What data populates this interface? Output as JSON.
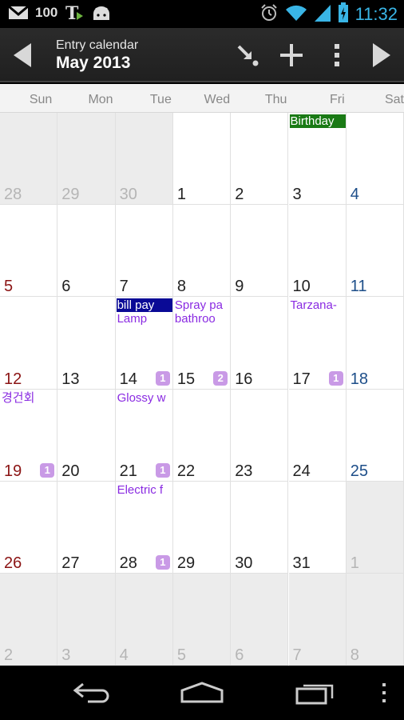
{
  "status_bar": {
    "battery_or_count": "100",
    "time": "11:32",
    "icons": [
      "gmail-icon",
      "talk-icon",
      "android-icon",
      "alarm-icon",
      "wifi-icon",
      "signal-icon",
      "battery-icon"
    ]
  },
  "action_bar": {
    "subtitle": "Entry calendar",
    "title": "May 2013",
    "buttons": [
      "prev-month-icon",
      "today-icon",
      "add-icon",
      "overflow-menu-icon",
      "next-month-icon"
    ]
  },
  "weekdays": [
    "Sun",
    "Mon",
    "Tue",
    "Wed",
    "Thu",
    "Fri",
    "Sat"
  ],
  "colors": {
    "sunday": "#8b1414",
    "saturday": "#1d4e89",
    "event_text": "#8a2be2",
    "badge": "#c99ae6",
    "event_green": "#1a7a15",
    "event_blue": "#0a0a96",
    "accent": "#39b5e6"
  },
  "weeks": [
    [
      {
        "day": "28",
        "other": true
      },
      {
        "day": "29",
        "other": true
      },
      {
        "day": "30",
        "other": true
      },
      {
        "day": "1"
      },
      {
        "day": "2"
      },
      {
        "day": "3",
        "events": [
          {
            "text": "Birthday",
            "style": "bar-green"
          }
        ]
      },
      {
        "day": "4"
      }
    ],
    [
      {
        "day": "5"
      },
      {
        "day": "6"
      },
      {
        "day": "7"
      },
      {
        "day": "8"
      },
      {
        "day": "9"
      },
      {
        "day": "10"
      },
      {
        "day": "11"
      }
    ],
    [
      {
        "day": "12"
      },
      {
        "day": "13"
      },
      {
        "day": "14",
        "badge": "1",
        "events": [
          {
            "text": "bill pay",
            "style": "bar-blue"
          },
          {
            "text": "Lamp"
          }
        ]
      },
      {
        "day": "15",
        "badge": "2",
        "events": [
          {
            "text": "Spray pa"
          },
          {
            "text": "bathroo"
          }
        ]
      },
      {
        "day": "16"
      },
      {
        "day": "17",
        "badge": "1",
        "events": [
          {
            "text": "Tarzana-"
          }
        ]
      },
      {
        "day": "18"
      }
    ],
    [
      {
        "day": "19",
        "badge": "1",
        "events": [
          {
            "text": "경건회"
          }
        ]
      },
      {
        "day": "20"
      },
      {
        "day": "21",
        "badge": "1",
        "events": [
          {
            "text": "Glossy w"
          }
        ]
      },
      {
        "day": "22"
      },
      {
        "day": "23"
      },
      {
        "day": "24"
      },
      {
        "day": "25"
      }
    ],
    [
      {
        "day": "26"
      },
      {
        "day": "27"
      },
      {
        "day": "28",
        "badge": "1",
        "events": [
          {
            "text": "Electric f"
          }
        ]
      },
      {
        "day": "29"
      },
      {
        "day": "30"
      },
      {
        "day": "31"
      },
      {
        "day": "1",
        "other": true
      }
    ],
    [
      {
        "day": "2",
        "other": true
      },
      {
        "day": "3",
        "other": true
      },
      {
        "day": "4",
        "other": true
      },
      {
        "day": "5",
        "other": true
      },
      {
        "day": "6",
        "other": true
      },
      {
        "day": "7",
        "other": true
      },
      {
        "day": "8",
        "other": true
      }
    ]
  ],
  "nav_bar": {
    "buttons": [
      "back-icon",
      "home-icon",
      "recent-apps-icon",
      "menu-icon"
    ]
  }
}
